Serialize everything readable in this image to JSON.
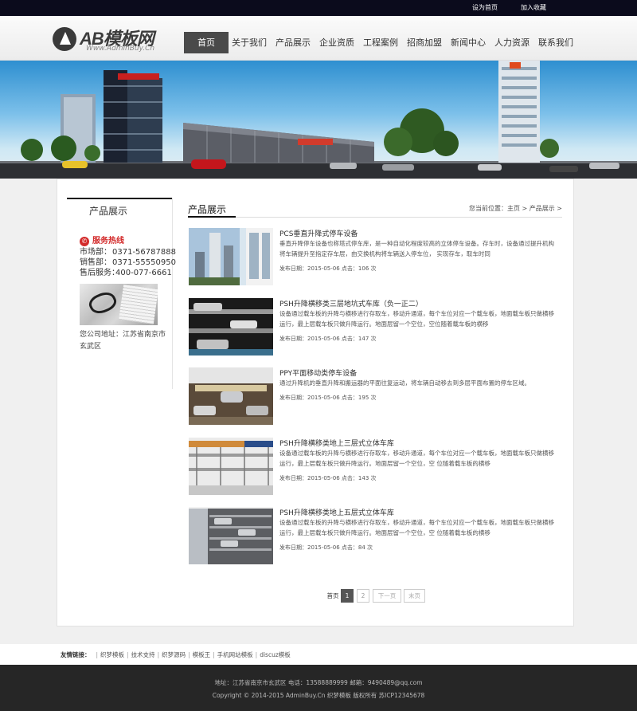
{
  "topbar": {
    "home_link": "设为首页",
    "favorite_link": "加入收藏"
  },
  "logo": {
    "title": "AB模板网",
    "subtitle": "Www.AdminBuy.Cn"
  },
  "nav": {
    "items": [
      {
        "label": "首页",
        "active": true
      },
      {
        "label": "关于我们"
      },
      {
        "label": "产品展示"
      },
      {
        "label": "企业资质"
      },
      {
        "label": "工程案例"
      },
      {
        "label": "招商加盟"
      },
      {
        "label": "新闻中心"
      },
      {
        "label": "人力资源"
      },
      {
        "label": "联系我们"
      }
    ]
  },
  "sidebar": {
    "title": "产品展示",
    "hotline": "服务热线",
    "contacts": [
      {
        "label": "市场部：",
        "value": "0371-56787888"
      },
      {
        "label": "销售部：",
        "value": "0371-55550950"
      },
      {
        "label": "售后服务：",
        "value": "400-077-6661"
      }
    ],
    "address": "您公司地址：江苏省南京市玄武区"
  },
  "content": {
    "title": "产品展示",
    "breadcrumb": "您当前位置：主页 > 产品展示 >",
    "products": [
      {
        "title": "PCS垂直升降式停车设备",
        "desc": "垂直升降停车设备也称塔式停车库，是一种自动化程度较高的立体停车设备。存车时，设备通过提升机构将车辆提升至指定存车层，由交换机构将车辆送入停车位， 实现存车，取车时同",
        "meta": "发布日期：2015-05-06 点击：106 次"
      },
      {
        "title": "PSH升降横移类三层地坑式车库（负一正二）",
        "desc": "设备通过载车板的升降与横移进行存取车，移动升通道，每个车位对应一个载车板，地面载车板只做横移运行，最上层载车板只做升降运行。地面层留一个空位，空位随着载车板的横移",
        "meta": "发布日期：2015-05-06 点击：147 次"
      },
      {
        "title": "PPY平面移动类停车设备",
        "desc": "通过升降机的垂直升降和搬运器的平面往复运动，将车辆自动移去到多层平面布置的停车区域。",
        "meta": "发布日期：2015-05-06 点击：195 次"
      },
      {
        "title": "PSH升降横移类地上三层式立体车库",
        "desc": "设备通过载车板的升降与横移进行存取车，移动升通道，每个车位对应一个载车板，地面载车板只做横移运行，最上层载车板只做升降运行。地面层留一个空位，空 位随着载车板的横移",
        "meta": "发布日期：2015-05-06 点击：143 次"
      },
      {
        "title": "PSH升降横移类地上五层式立体车库",
        "desc": "设备通过载车板的升降与横移进行存取车，移动升通道，每个车位对应一个载车板，地面载车板只做横移运行，最上层载车板只做升降运行。地面层留一个空位，空 位随着载车板的横移",
        "meta": "发布日期：2015-05-06 点击：84 次"
      }
    ]
  },
  "pager": {
    "first": "首页",
    "page1": "1",
    "page2": "2",
    "next": "下一页",
    "last": "末页"
  },
  "friend_links": {
    "label": "友情链接：",
    "items": [
      "织梦模板",
      "技术支持",
      "织梦源码",
      "模板王",
      "手机网站模板",
      "discuz模板"
    ]
  },
  "footer": {
    "line1": "地址：江苏省南京市玄武区    电话：13588889999    邮箱：9490489@qq.com",
    "line2": "Copyright © 2014-2015 AdminBuy.Cn 织梦模板 版权所有    苏ICP12345678"
  },
  "colors": {
    "topbar": "#0b0b1c",
    "nav_active": "#4a4a4a",
    "hotline": "#d32b2b",
    "footer": "#262626"
  }
}
